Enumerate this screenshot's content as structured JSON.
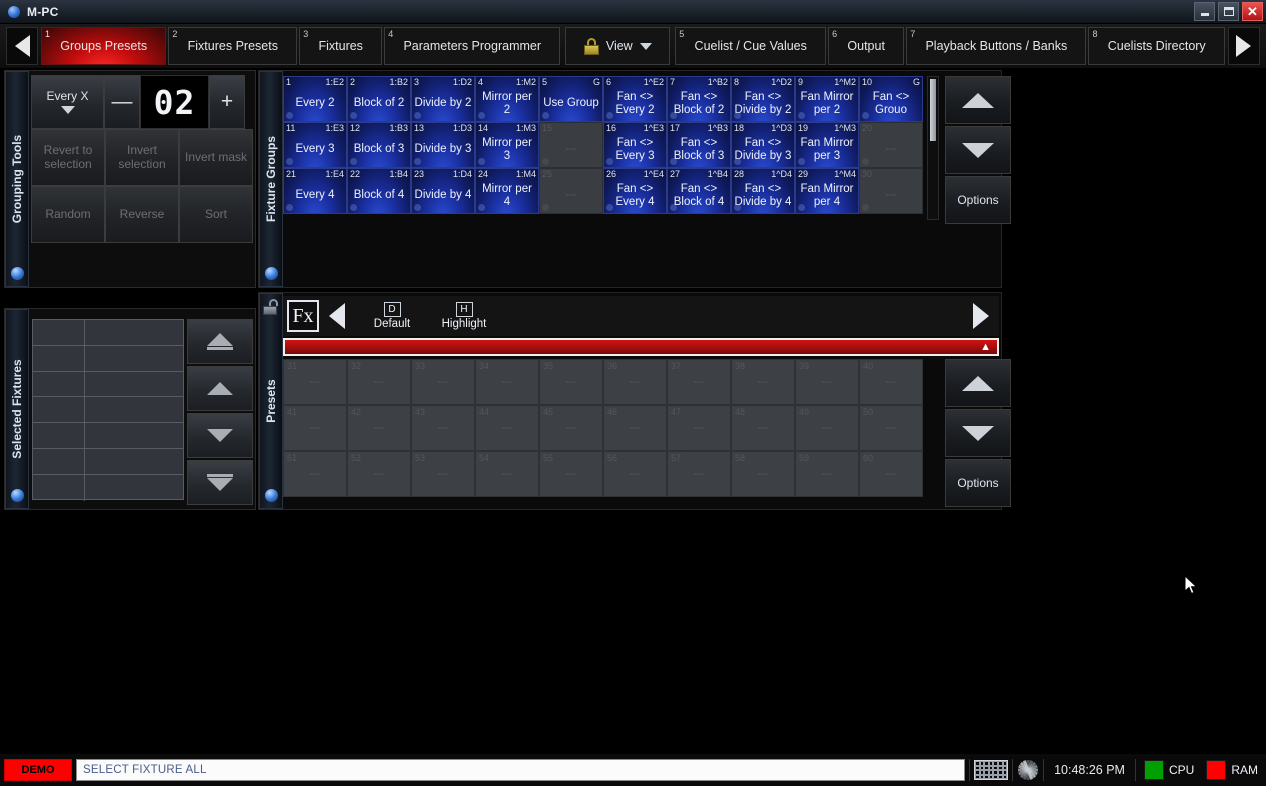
{
  "window": {
    "title": "M-PC",
    "app_icon": "app-orb-icon",
    "controls": {
      "minimize": "minimize",
      "maximize": "maximize",
      "close": "close"
    }
  },
  "tabbar": {
    "prev_label": "prev-page",
    "next_label": "next-page",
    "tabs": [
      {
        "num": "1",
        "label": "Groups Presets",
        "active": true
      },
      {
        "num": "2",
        "label": "Fixtures Presets",
        "active": false
      },
      {
        "num": "3",
        "label": "Fixtures",
        "active": false
      },
      {
        "num": "4",
        "label": "Parameters Programmer",
        "active": false
      }
    ],
    "view_button": {
      "label": "View",
      "icon": "lock-icon",
      "caret": "chevron-down-icon"
    },
    "tabs2": [
      {
        "num": "5",
        "label": "Cuelist / Cue Values",
        "active": false
      },
      {
        "num": "6",
        "label": "Output",
        "active": false
      },
      {
        "num": "7",
        "label": "Playback Buttons / Banks",
        "active": false
      },
      {
        "num": "8",
        "label": "Cuelists Directory",
        "active": false
      }
    ]
  },
  "grouping_tools": {
    "rail_label": "Grouping Tools",
    "mode_select": "Every X",
    "minus": "—",
    "value": "02",
    "plus": "+",
    "buttons": [
      "Revert to selection",
      "Invert selection",
      "Invert mask",
      "Random",
      "Reverse",
      "Sort"
    ]
  },
  "selected_fixtures": {
    "rail_label": "Selected Fixtures",
    "rows": 7,
    "nav": [
      "top-icon",
      "up-icon",
      "down-icon",
      "bottom-icon"
    ]
  },
  "fixture_groups": {
    "rail_label": "Fixture Groups",
    "cells": [
      {
        "num": "1",
        "tag": "1:E2",
        "label": "Every 2",
        "filled": true
      },
      {
        "num": "2",
        "tag": "1:B2",
        "label": "Block of 2",
        "filled": true
      },
      {
        "num": "3",
        "tag": "1:D2",
        "label": "Divide by 2",
        "filled": true
      },
      {
        "num": "4",
        "tag": "1:M2",
        "label": "Mirror per 2",
        "filled": true
      },
      {
        "num": "5",
        "tag": "G",
        "label": "Use Group",
        "filled": true
      },
      {
        "num": "6",
        "tag": "1^E2",
        "label": "Fan <> Every 2",
        "filled": true
      },
      {
        "num": "7",
        "tag": "1^B2",
        "label": "Fan <> Block of 2",
        "filled": true
      },
      {
        "num": "8",
        "tag": "1^D2",
        "label": "Fan <> Divide by 2",
        "filled": true
      },
      {
        "num": "9",
        "tag": "1^M2",
        "label": "Fan Mirror per 2",
        "filled": true
      },
      {
        "num": "10",
        "tag": "G",
        "label": "Fan <> Grouo",
        "filled": true
      },
      {
        "num": "11",
        "tag": "1:E3",
        "label": "Every 3",
        "filled": true
      },
      {
        "num": "12",
        "tag": "1:B3",
        "label": "Block of 3",
        "filled": true
      },
      {
        "num": "13",
        "tag": "1:D3",
        "label": "Divide by 3",
        "filled": true
      },
      {
        "num": "14",
        "tag": "1:M3",
        "label": "Mirror per 3",
        "filled": true
      },
      {
        "num": "15",
        "tag": "",
        "label": "---",
        "filled": false
      },
      {
        "num": "16",
        "tag": "1^E3",
        "label": "Fan <> Every 3",
        "filled": true
      },
      {
        "num": "17",
        "tag": "1^B3",
        "label": "Fan <> Block of 3",
        "filled": true
      },
      {
        "num": "18",
        "tag": "1^D3",
        "label": "Fan <> Divide by 3",
        "filled": true
      },
      {
        "num": "19",
        "tag": "1^M3",
        "label": "Fan Mirror per 3",
        "filled": true
      },
      {
        "num": "20",
        "tag": "",
        "label": "---",
        "filled": false
      },
      {
        "num": "21",
        "tag": "1:E4",
        "label": "Every 4",
        "filled": true
      },
      {
        "num": "22",
        "tag": "1:B4",
        "label": "Block of 4",
        "filled": true
      },
      {
        "num": "23",
        "tag": "1:D4",
        "label": "Divide by 4",
        "filled": true
      },
      {
        "num": "24",
        "tag": "1:M4",
        "label": "Mirror per 4",
        "filled": true
      },
      {
        "num": "25",
        "tag": "",
        "label": "---",
        "filled": false
      },
      {
        "num": "26",
        "tag": "1^E4",
        "label": "Fan <> Every 4",
        "filled": true
      },
      {
        "num": "27",
        "tag": "1^B4",
        "label": "Fan <> Block of 4",
        "filled": true
      },
      {
        "num": "28",
        "tag": "1^D4",
        "label": "Fan <> Divide by 4",
        "filled": true
      },
      {
        "num": "29",
        "tag": "1^M4",
        "label": "Fan Mirror per 4",
        "filled": true
      },
      {
        "num": "30",
        "tag": "",
        "label": "---",
        "filled": false
      }
    ],
    "side_buttons": [
      "up-icon",
      "down-icon",
      "Options"
    ],
    "options_label": "Options"
  },
  "presets": {
    "rail_label": "Presets",
    "toolbar": {
      "unlock_icon": "unlock-icon",
      "fx_label": "Fx",
      "back_arrow": "arrow-left-icon",
      "items": [
        {
          "key": "D",
          "label": "Default"
        },
        {
          "key": "H",
          "label": "Highlight"
        }
      ],
      "forward_arrow": "arrow-right-icon"
    },
    "collapse_icon": "chevron-double-up-icon",
    "empty_label": "---",
    "cells": [
      {
        "num": "31"
      },
      {
        "num": "32"
      },
      {
        "num": "33"
      },
      {
        "num": "34"
      },
      {
        "num": "35"
      },
      {
        "num": "36"
      },
      {
        "num": "37"
      },
      {
        "num": "38"
      },
      {
        "num": "39"
      },
      {
        "num": "40"
      },
      {
        "num": "41"
      },
      {
        "num": "42"
      },
      {
        "num": "43"
      },
      {
        "num": "44"
      },
      {
        "num": "45"
      },
      {
        "num": "46"
      },
      {
        "num": "47"
      },
      {
        "num": "48"
      },
      {
        "num": "49"
      },
      {
        "num": "50"
      },
      {
        "num": "51"
      },
      {
        "num": "52"
      },
      {
        "num": "53"
      },
      {
        "num": "54"
      },
      {
        "num": "55"
      },
      {
        "num": "56"
      },
      {
        "num": "57"
      },
      {
        "num": "58"
      },
      {
        "num": "59"
      },
      {
        "num": "60"
      }
    ],
    "side_buttons": [
      "up-icon",
      "down-icon",
      "Options"
    ],
    "options_label": "Options"
  },
  "statusbar": {
    "demo_badge": "DEMO",
    "command_line": "SELECT FIXTURE ALL",
    "keyboard_icon": "keyboard-icon",
    "settings_icon": "gear-icon",
    "clock": "10:48:26 PM",
    "cpu_label": "CPU",
    "ram_label": "RAM"
  },
  "colors": {
    "accent_red": "#c50d0d",
    "group_blue": "#1a2fa0",
    "cpu_green": "#00a000",
    "ram_red": "#ff0000",
    "lock_gold": "#c8b23c"
  }
}
